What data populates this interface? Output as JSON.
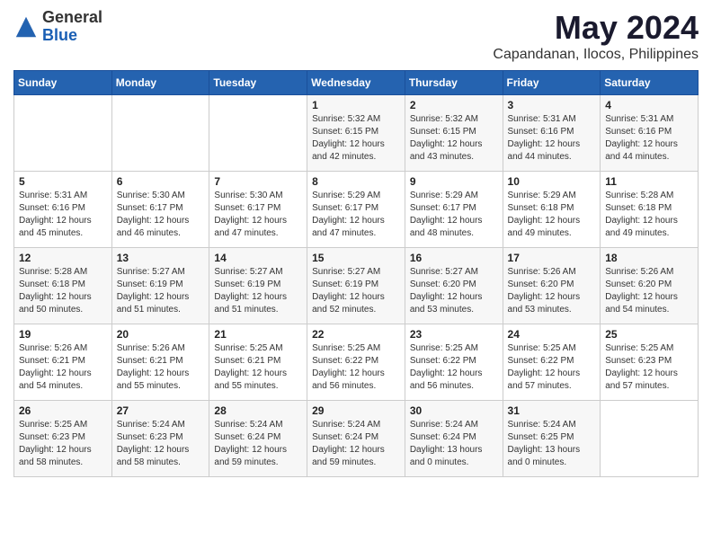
{
  "logo": {
    "general": "General",
    "blue": "Blue"
  },
  "title": {
    "month_year": "May 2024",
    "location": "Capandanan, Ilocos, Philippines"
  },
  "headers": [
    "Sunday",
    "Monday",
    "Tuesday",
    "Wednesday",
    "Thursday",
    "Friday",
    "Saturday"
  ],
  "weeks": [
    [
      {
        "day": "",
        "info": ""
      },
      {
        "day": "",
        "info": ""
      },
      {
        "day": "",
        "info": ""
      },
      {
        "day": "1",
        "info": "Sunrise: 5:32 AM\nSunset: 6:15 PM\nDaylight: 12 hours\nand 42 minutes."
      },
      {
        "day": "2",
        "info": "Sunrise: 5:32 AM\nSunset: 6:15 PM\nDaylight: 12 hours\nand 43 minutes."
      },
      {
        "day": "3",
        "info": "Sunrise: 5:31 AM\nSunset: 6:16 PM\nDaylight: 12 hours\nand 44 minutes."
      },
      {
        "day": "4",
        "info": "Sunrise: 5:31 AM\nSunset: 6:16 PM\nDaylight: 12 hours\nand 44 minutes."
      }
    ],
    [
      {
        "day": "5",
        "info": "Sunrise: 5:31 AM\nSunset: 6:16 PM\nDaylight: 12 hours\nand 45 minutes."
      },
      {
        "day": "6",
        "info": "Sunrise: 5:30 AM\nSunset: 6:17 PM\nDaylight: 12 hours\nand 46 minutes."
      },
      {
        "day": "7",
        "info": "Sunrise: 5:30 AM\nSunset: 6:17 PM\nDaylight: 12 hours\nand 47 minutes."
      },
      {
        "day": "8",
        "info": "Sunrise: 5:29 AM\nSunset: 6:17 PM\nDaylight: 12 hours\nand 47 minutes."
      },
      {
        "day": "9",
        "info": "Sunrise: 5:29 AM\nSunset: 6:17 PM\nDaylight: 12 hours\nand 48 minutes."
      },
      {
        "day": "10",
        "info": "Sunrise: 5:29 AM\nSunset: 6:18 PM\nDaylight: 12 hours\nand 49 minutes."
      },
      {
        "day": "11",
        "info": "Sunrise: 5:28 AM\nSunset: 6:18 PM\nDaylight: 12 hours\nand 49 minutes."
      }
    ],
    [
      {
        "day": "12",
        "info": "Sunrise: 5:28 AM\nSunset: 6:18 PM\nDaylight: 12 hours\nand 50 minutes."
      },
      {
        "day": "13",
        "info": "Sunrise: 5:27 AM\nSunset: 6:19 PM\nDaylight: 12 hours\nand 51 minutes."
      },
      {
        "day": "14",
        "info": "Sunrise: 5:27 AM\nSunset: 6:19 PM\nDaylight: 12 hours\nand 51 minutes."
      },
      {
        "day": "15",
        "info": "Sunrise: 5:27 AM\nSunset: 6:19 PM\nDaylight: 12 hours\nand 52 minutes."
      },
      {
        "day": "16",
        "info": "Sunrise: 5:27 AM\nSunset: 6:20 PM\nDaylight: 12 hours\nand 53 minutes."
      },
      {
        "day": "17",
        "info": "Sunrise: 5:26 AM\nSunset: 6:20 PM\nDaylight: 12 hours\nand 53 minutes."
      },
      {
        "day": "18",
        "info": "Sunrise: 5:26 AM\nSunset: 6:20 PM\nDaylight: 12 hours\nand 54 minutes."
      }
    ],
    [
      {
        "day": "19",
        "info": "Sunrise: 5:26 AM\nSunset: 6:21 PM\nDaylight: 12 hours\nand 54 minutes."
      },
      {
        "day": "20",
        "info": "Sunrise: 5:26 AM\nSunset: 6:21 PM\nDaylight: 12 hours\nand 55 minutes."
      },
      {
        "day": "21",
        "info": "Sunrise: 5:25 AM\nSunset: 6:21 PM\nDaylight: 12 hours\nand 55 minutes."
      },
      {
        "day": "22",
        "info": "Sunrise: 5:25 AM\nSunset: 6:22 PM\nDaylight: 12 hours\nand 56 minutes."
      },
      {
        "day": "23",
        "info": "Sunrise: 5:25 AM\nSunset: 6:22 PM\nDaylight: 12 hours\nand 56 minutes."
      },
      {
        "day": "24",
        "info": "Sunrise: 5:25 AM\nSunset: 6:22 PM\nDaylight: 12 hours\nand 57 minutes."
      },
      {
        "day": "25",
        "info": "Sunrise: 5:25 AM\nSunset: 6:23 PM\nDaylight: 12 hours\nand 57 minutes."
      }
    ],
    [
      {
        "day": "26",
        "info": "Sunrise: 5:25 AM\nSunset: 6:23 PM\nDaylight: 12 hours\nand 58 minutes."
      },
      {
        "day": "27",
        "info": "Sunrise: 5:24 AM\nSunset: 6:23 PM\nDaylight: 12 hours\nand 58 minutes."
      },
      {
        "day": "28",
        "info": "Sunrise: 5:24 AM\nSunset: 6:24 PM\nDaylight: 12 hours\nand 59 minutes."
      },
      {
        "day": "29",
        "info": "Sunrise: 5:24 AM\nSunset: 6:24 PM\nDaylight: 12 hours\nand 59 minutes."
      },
      {
        "day": "30",
        "info": "Sunrise: 5:24 AM\nSunset: 6:24 PM\nDaylight: 13 hours\nand 0 minutes."
      },
      {
        "day": "31",
        "info": "Sunrise: 5:24 AM\nSunset: 6:25 PM\nDaylight: 13 hours\nand 0 minutes."
      },
      {
        "day": "",
        "info": ""
      }
    ]
  ]
}
